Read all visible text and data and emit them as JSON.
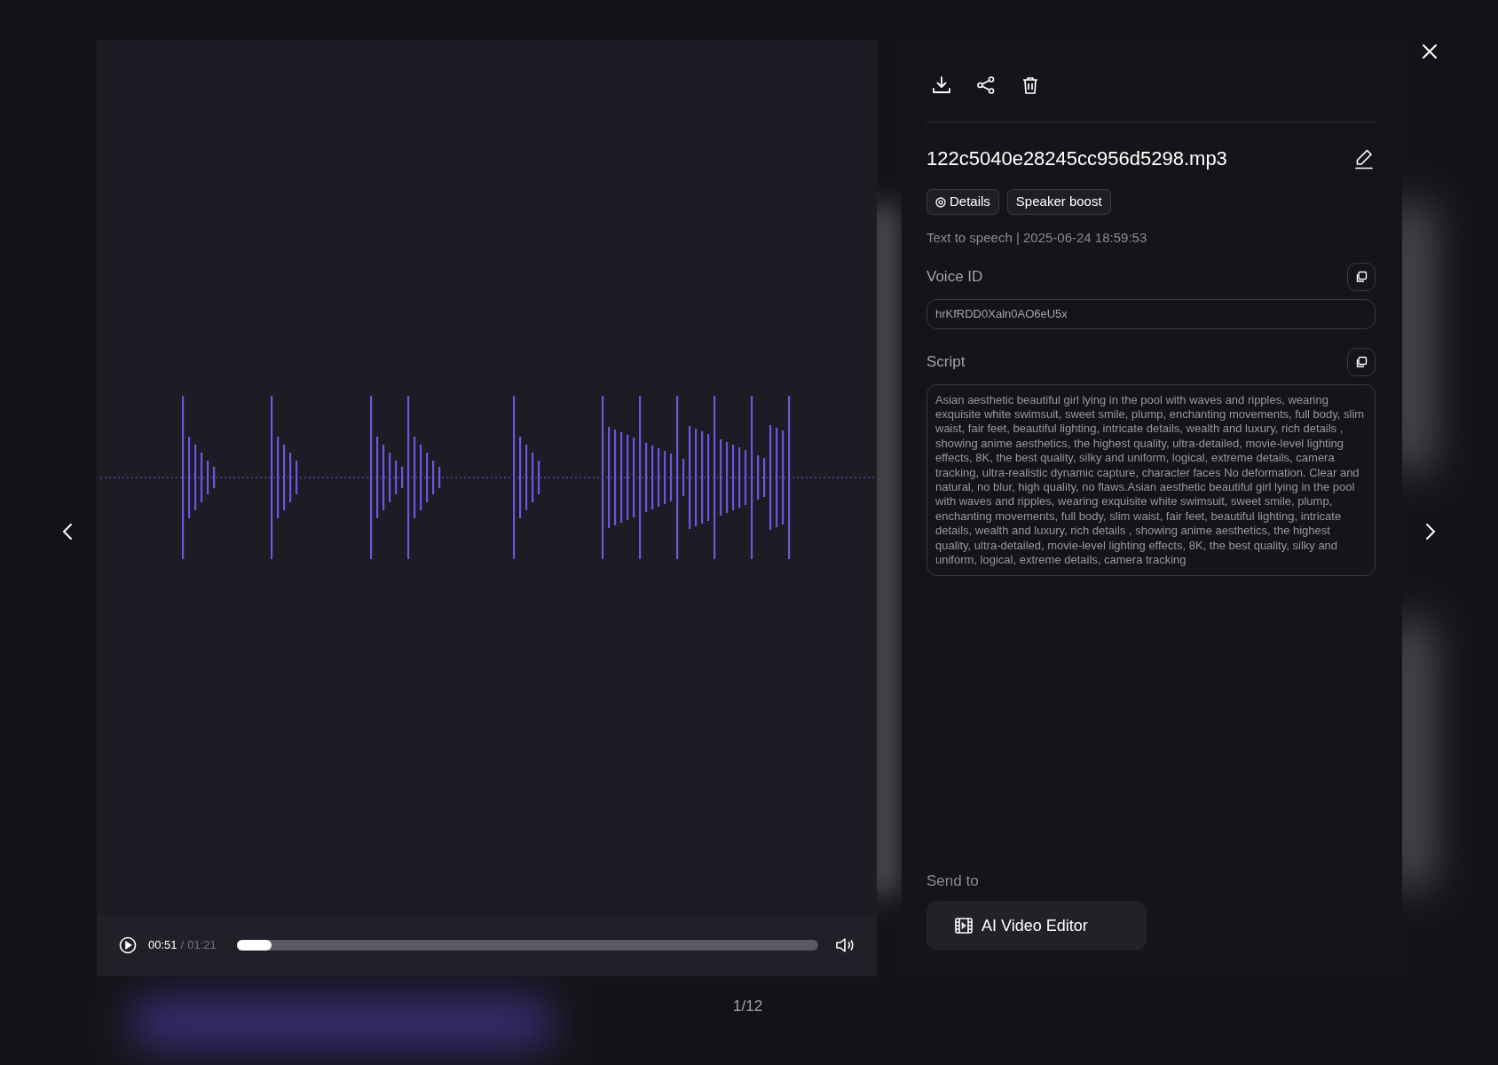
{
  "file": {
    "name": "122c5040e28245cc956d5298.mp3"
  },
  "tags": [
    {
      "kind": "info",
      "label": "Details"
    },
    {
      "kind": "plain",
      "label": "Speaker boost"
    }
  ],
  "meta": "Text to speech | 2025-06-24 18:59:53",
  "voice_id": {
    "label": "Voice ID",
    "value": "hrKfRDD0Xaln0AO6eU5x"
  },
  "script": {
    "label": "Script",
    "value": "Asian aesthetic beautiful girl lying in the pool with waves and ripples, wearing exquisite white swimsuit, sweet smile, plump, enchanting movements, full body, slim waist, fair feet, beautiful lighting, intricate details, wealth and luxury, rich details , showing anime aesthetics, the highest quality, ultra-detailed, movie-level lighting effects, 8K, the best quality, silky and uniform, logical, extreme details, camera tracking, ultra-realistic dynamic capture, character faces No deformation. Clear and natural, no blur, high quality, no flaws.Asian aesthetic beautiful girl lying in the pool with waves and ripples, wearing exquisite white swimsuit, sweet smile, plump, enchanting movements, full body, slim waist, fair feet, beautiful lighting, intricate details, wealth and luxury, rich details , showing anime aesthetics, the highest quality, ultra-detailed, movie-level lighting effects, 8K, the best quality, silky and uniform, logical, extreme details, camera tracking"
  },
  "send_to": {
    "label": "Send to",
    "button": "AI Video Editor"
  },
  "player": {
    "current": "00:51",
    "separator": "/",
    "total": "01:21",
    "level": 0.06
  },
  "counter": "1/12"
}
